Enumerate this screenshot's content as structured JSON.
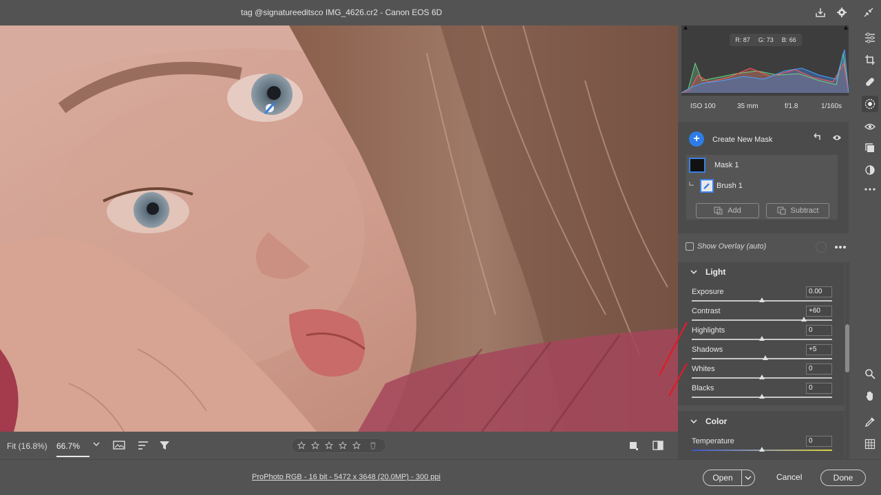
{
  "window": {
    "title": "tag @signatureeditsco IMG_4626.cr2  -  Canon EOS 6D"
  },
  "histogram": {
    "r_label": "R: 87",
    "g_label": "G: 73",
    "b_label": "B: 66"
  },
  "camera": {
    "iso": "ISO 100",
    "focal": "35 mm",
    "aperture": "f/1.8",
    "shutter": "1/160s"
  },
  "masking": {
    "create_label": "Create New Mask",
    "mask_name": "Mask 1",
    "brush_name": "Brush 1",
    "add_label": "Add",
    "subtract_label": "Subtract",
    "overlay_label": "Show Overlay (auto)"
  },
  "light": {
    "title": "Light",
    "sliders": [
      {
        "name": "Exposure",
        "value": "0.00",
        "level": 0.5
      },
      {
        "name": "Contrast",
        "value": "+60",
        "level": 0.8
      },
      {
        "name": "Highlights",
        "value": "0",
        "level": 0.5
      },
      {
        "name": "Shadows",
        "value": "+5",
        "level": 0.525
      },
      {
        "name": "Whites",
        "value": "0",
        "level": 0.5
      },
      {
        "name": "Blacks",
        "value": "0",
        "level": 0.5
      }
    ]
  },
  "color": {
    "title": "Color",
    "sliders": [
      {
        "name": "Temperature",
        "value": "0",
        "level": 0.5
      }
    ]
  },
  "image_toolbar": {
    "fit_label": "Fit (16.8%)",
    "zoom_label": "66.7%"
  },
  "status": {
    "workflow_link": "ProPhoto RGB - 16 bit - 5472 x 3648 (20.0MP) - 300 ppi",
    "open_label": "Open",
    "cancel_label": "Cancel",
    "done_label": "Done"
  },
  "colors": {
    "accent": "#2d7ce8",
    "panel_bg": "#535353",
    "section_bg": "#4b4b4b"
  }
}
